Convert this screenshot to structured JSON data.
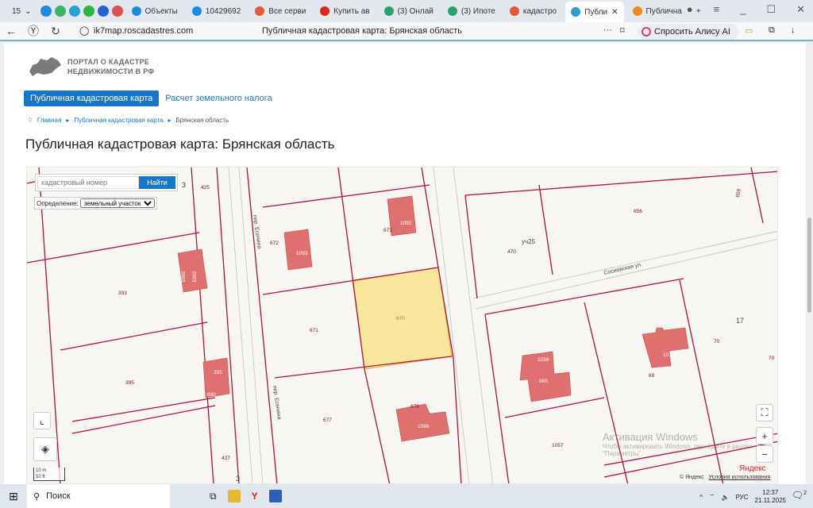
{
  "browser": {
    "tab_count": "15",
    "tabs": [
      {
        "label": "Объекты",
        "color": "#1c8be0"
      },
      {
        "label": "10429692",
        "color": "#1c8be0"
      },
      {
        "label": "Все серви",
        "color": "#e25a3c"
      },
      {
        "label": "Купить ав",
        "color": "#e0251b"
      },
      {
        "label": "(3) Онлай",
        "color": "#2aa36b"
      },
      {
        "label": "(3) Ипоте",
        "color": "#2aa36b"
      },
      {
        "label": "кадастро",
        "color": "#e25a3c"
      },
      {
        "label": "Публи",
        "color": "#2aa0c8",
        "active": true
      },
      {
        "label": "Публична",
        "color": "#f08a1c"
      }
    ],
    "url": "ik7map.roscadastres.com",
    "page_title": "Публичная кадастровая карта: Брянская область",
    "alice_label": "Спросить Алису AI"
  },
  "site": {
    "logo_line1": "ПОРТАЛ О КАДАСТРЕ",
    "logo_line2": "НЕДВИЖИМОСТИ В РФ",
    "nav": [
      "Публичная кадастровая карта",
      "Расчет земельного налога"
    ],
    "breadcrumb": [
      "Главная",
      "Публичная кадастровая карта",
      "Брянская область"
    ],
    "heading": "Публичная кадастровая карта: Брянская область"
  },
  "map": {
    "search_placeholder": "кадастровый номер",
    "search_button": "Найти",
    "definition_label": "Определение:",
    "definition_value": "земельный участок",
    "selected_parcel": "670",
    "highlight_color": "#f8e79a",
    "boundary_color": "#b0123a",
    "building_color": "#e07070",
    "parcels": [
      "425",
      "3",
      "393",
      "395",
      "427",
      "672",
      "671",
      "677",
      "673",
      "670",
      "676",
      "470",
      "656",
      "659",
      "17",
      "70",
      "70",
      "69",
      "1057",
      "3"
    ],
    "buildings": [
      "1092",
      "1093",
      "1092",
      "1092",
      "395",
      "690",
      "1089",
      "1056",
      "865",
      "1077"
    ],
    "roads": [
      "пер. Есенина",
      "пер. Есенина",
      "Сосновская ул.",
      "уч25"
    ],
    "scale_m": "10 m",
    "scale_ft": "50 ft",
    "zoom_in": "+",
    "zoom_out": "−",
    "provider": "Яндекс",
    "copyright": "© Яндекс",
    "terms": "Условия использования"
  },
  "watermark": {
    "title": "Активация Windows",
    "text": "Чтобы активировать Windows, перейдите в раздел \"Параметры\"."
  },
  "taskbar": {
    "search": "Поиск",
    "lang": "РУС",
    "time": "12:37",
    "date": "21.11.2025",
    "notifications": "2"
  }
}
